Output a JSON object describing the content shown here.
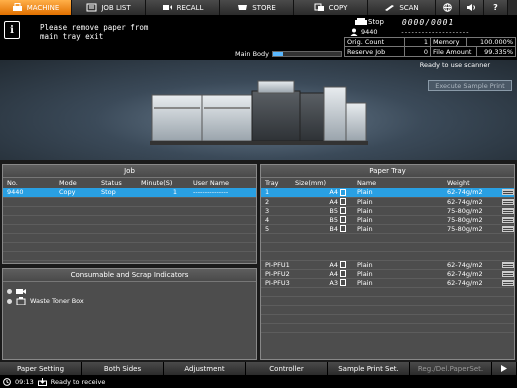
{
  "tabs": [
    {
      "label": "MACHINE",
      "icon": "printer-icon",
      "active": true
    },
    {
      "label": "JOB LIST",
      "icon": "list-icon",
      "active": false
    },
    {
      "label": "RECALL",
      "icon": "recall-icon",
      "active": false
    },
    {
      "label": "STORE",
      "icon": "store-icon",
      "active": false
    },
    {
      "label": "COPY",
      "icon": "copy-icon",
      "active": false
    },
    {
      "label": "SCAN",
      "icon": "scan-icon",
      "active": false
    }
  ],
  "message": {
    "line1": "Please remove paper from",
    "line2": "main tray exit"
  },
  "main_body": {
    "label": "Main Body",
    "level": 0.15
  },
  "status": {
    "state": "Stop",
    "counter": "0000/0001",
    "job_number": "9440",
    "dashes": "--------------------",
    "orig_count_label": "Orig. Count",
    "orig_count": "1",
    "memory_label": "Memory",
    "memory": "100.000%",
    "reserve_job_label": "Reserve Job",
    "reserve_job": "0",
    "file_amount_label": "File Amount",
    "file_amount": "99.335%"
  },
  "ready_scanner": "Ready to use scanner",
  "execute_sample_print": "Execute Sample Print",
  "job_panel": {
    "title": "Job",
    "headers": [
      "No.",
      "Mode",
      "Status",
      "Minute(S)",
      "User Name"
    ],
    "rows": [
      {
        "no": "9440",
        "mode": "Copy",
        "status": "Stop",
        "minutes": "1",
        "user": "---------------"
      }
    ]
  },
  "consumable_panel": {
    "title": "Consumable and Scrap Indicators",
    "items": [
      {
        "label": ""
      },
      {
        "label": "Waste Toner Box"
      }
    ]
  },
  "tray_panel": {
    "title": "Paper Tray",
    "headers": [
      "Tray",
      "Size(mm)",
      "Name",
      "Weight"
    ],
    "rows": [
      {
        "tray": "1",
        "size": "A4",
        "name": "Plain",
        "weight": "62-74g/m2"
      },
      {
        "tray": "2",
        "size": "A4",
        "name": "Plain",
        "weight": "62-74g/m2"
      },
      {
        "tray": "3",
        "size": "B5",
        "name": "Plain",
        "weight": "75-80g/m2"
      },
      {
        "tray": "4",
        "size": "B5",
        "name": "Plain",
        "weight": "75-80g/m2"
      },
      {
        "tray": "5",
        "size": "B4",
        "name": "Plain",
        "weight": "75-80g/m2"
      }
    ],
    "pfu_rows": [
      {
        "tray": "PI-PFU1",
        "size": "A4",
        "name": "Plain",
        "weight": "62-74g/m2"
      },
      {
        "tray": "PI-PFU2",
        "size": "A4",
        "name": "Plain",
        "weight": "62-74g/m2"
      },
      {
        "tray": "PI-PFU3",
        "size": "A3",
        "name": "Plain",
        "weight": "62-74g/m2"
      }
    ]
  },
  "bottom_tabs": [
    {
      "label": "Paper Setting",
      "dim": false
    },
    {
      "label": "Both Sides",
      "dim": false
    },
    {
      "label": "Adjustment",
      "dim": false
    },
    {
      "label": "Controller",
      "dim": false
    },
    {
      "label": "Sample Print Set.",
      "dim": false
    },
    {
      "label": "Reg./Del.PaperSet.",
      "dim": true
    }
  ],
  "status_line": {
    "time": "09:13",
    "text": "Ready to receive"
  },
  "colors": {
    "active_tab": "#f08a1c",
    "selected_row": "#29a0e3",
    "panel": "#4d4d4d"
  }
}
